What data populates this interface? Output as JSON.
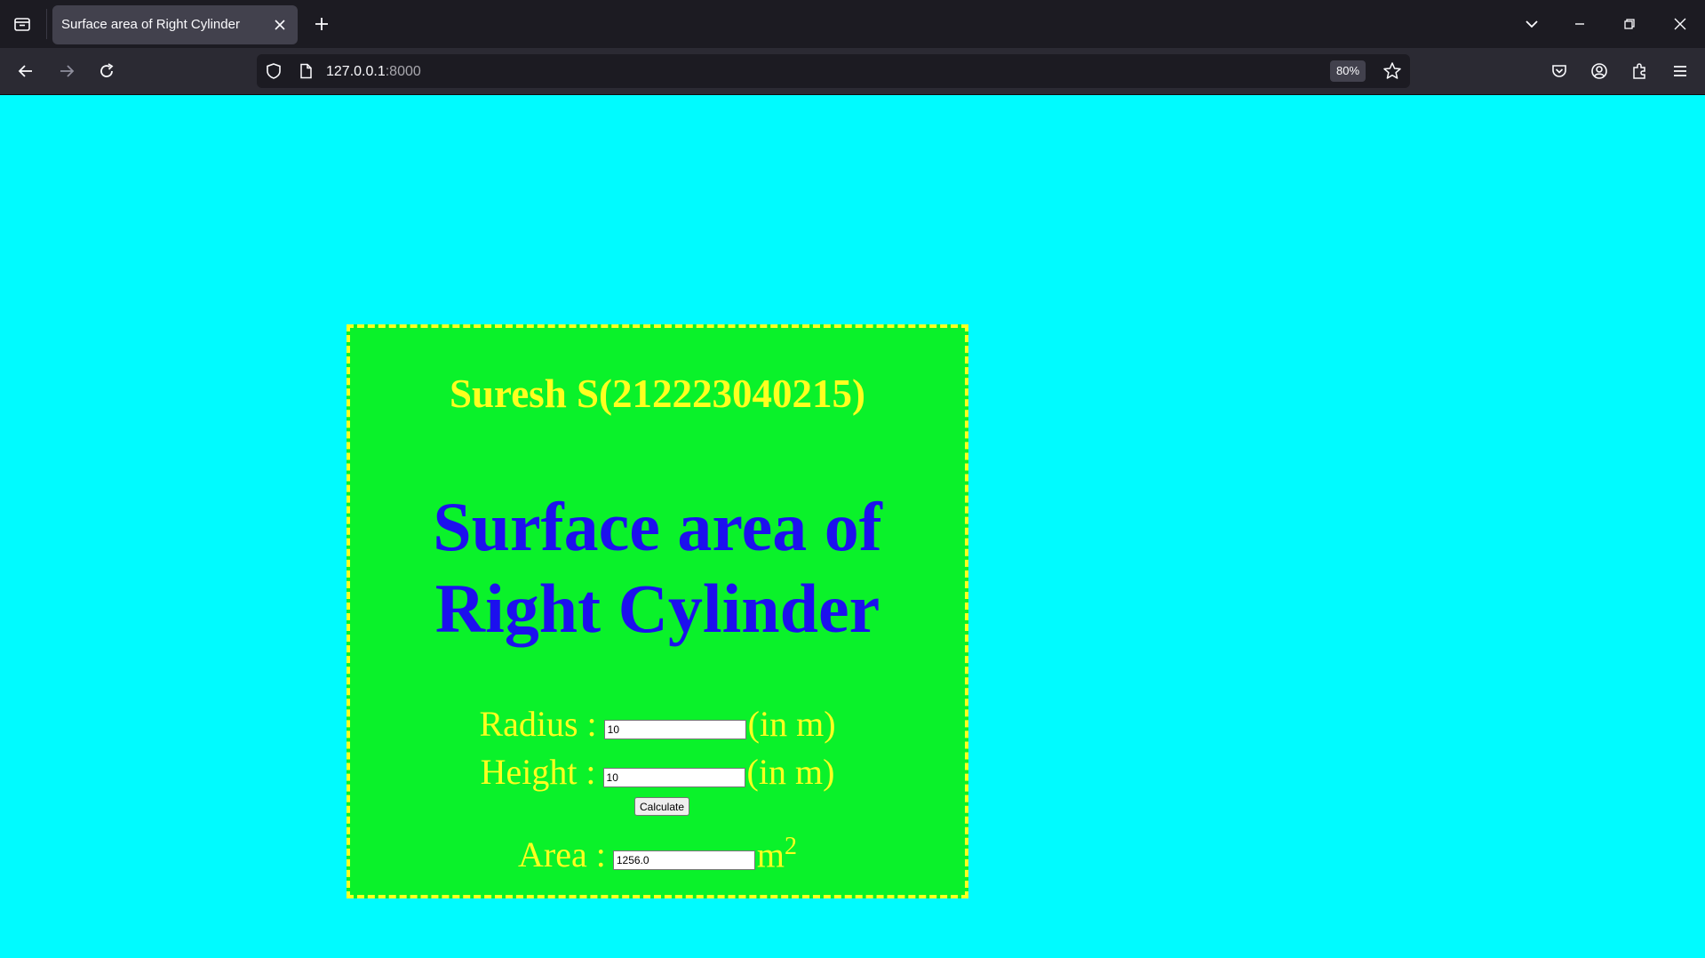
{
  "browser": {
    "tab_title": "Surface area of Right Cylinder",
    "url_host": "127.0.0.1",
    "url_port": ":8000",
    "zoom": "80%"
  },
  "page": {
    "student": "Suresh S(212223040215)",
    "heading_line1": "Surface area of",
    "heading_line2": "Right Cylinder",
    "radius_label": "Radius : ",
    "radius_value": "10",
    "radius_unit": "(in m)",
    "height_label": "Height : ",
    "height_value": "10",
    "height_unit": "(in m)",
    "calculate_label": "Calculate",
    "area_label": "Area : ",
    "area_value": "1256.0",
    "area_unit": "m",
    "area_unit_sup": "2"
  },
  "colors": {
    "page_bg": "#00fbff",
    "card_bg": "#0af22a",
    "card_border": "#ffff1f",
    "label_color": "#ffff1f",
    "heading_color": "#1c10ee"
  }
}
